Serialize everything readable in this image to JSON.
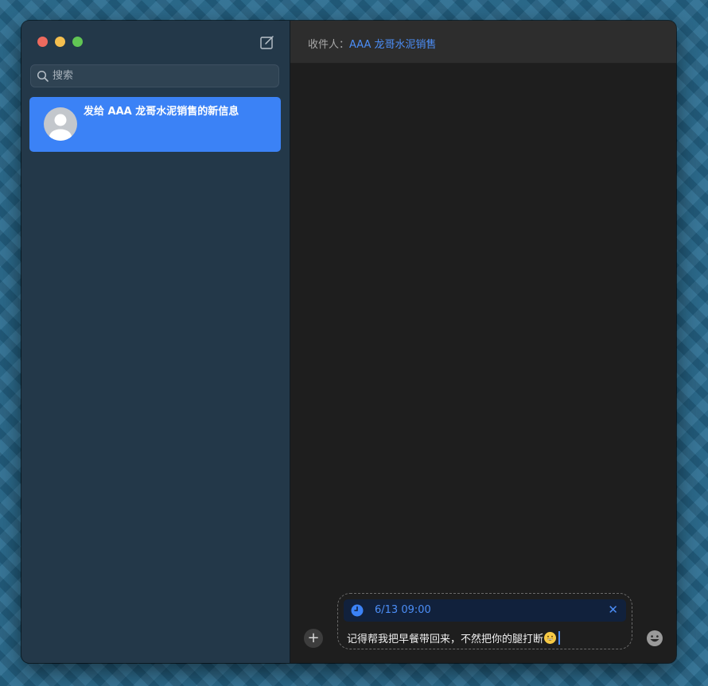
{
  "window": {
    "buttons": {
      "close": "close",
      "minimize": "minimize",
      "zoom": "zoom"
    }
  },
  "sidebar": {
    "compose_icon": "compose-icon",
    "search": {
      "placeholder": "搜索",
      "value": ""
    },
    "conversations": [
      {
        "title": "发给 AAA 龙哥水泥销售的新信息",
        "selected": true,
        "avatar": "person-icon"
      }
    ]
  },
  "header": {
    "to_label": "收件人：",
    "recipient": "AAA 龙哥水泥销售"
  },
  "composer": {
    "schedule": {
      "icon": "clock-icon",
      "time": "6/13  09:00",
      "remove_icon": "close-icon"
    },
    "message": "记得帮我把早餐带回来，不然把你的腿打断",
    "message_emoji": "grinning-face"
  },
  "colors": {
    "accent": "#3b82f6",
    "link": "#4c8ef7",
    "sidebar_bg": "#233849",
    "main_bg": "#1e1e1e"
  }
}
